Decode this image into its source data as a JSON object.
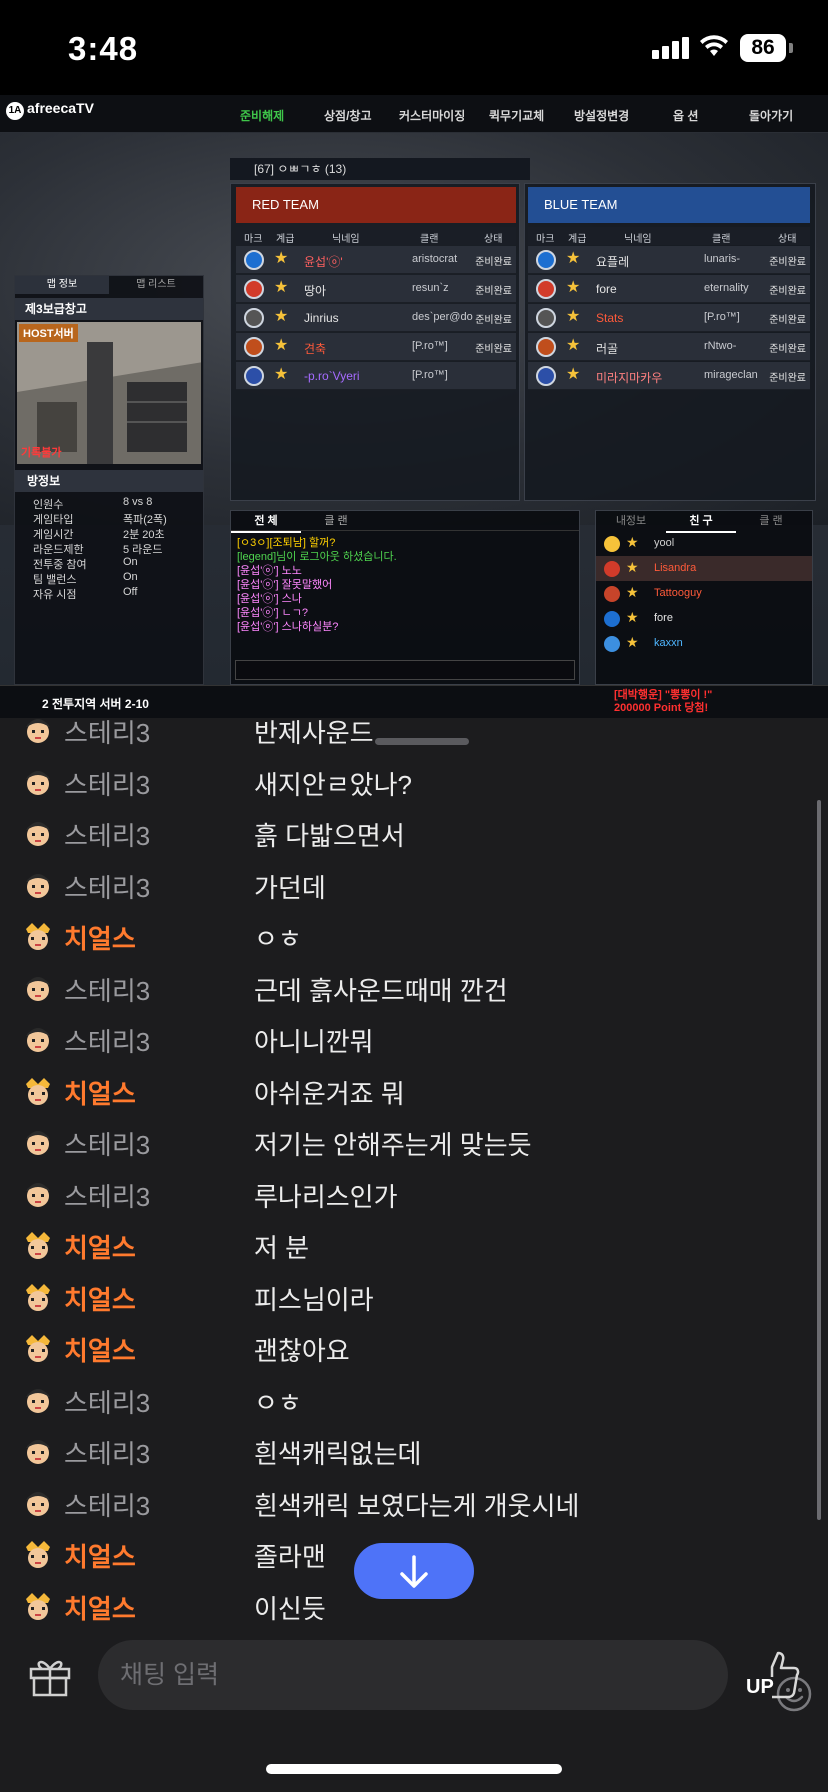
{
  "status_bar": {
    "time": "3:48",
    "battery": "86"
  },
  "game": {
    "logo": "afreecaTV",
    "menu": [
      {
        "label": "준비해제",
        "active": true
      },
      {
        "label": "상점/창고",
        "active": false
      },
      {
        "label": "커스터마이징",
        "active": false
      },
      {
        "label": "퀵무기교체",
        "active": false
      },
      {
        "label": "방설정변경",
        "active": false
      },
      {
        "label": "옵 션",
        "active": false
      },
      {
        "label": "돌아가기",
        "active": false
      }
    ],
    "room_title": "[67] ㅇㅃㄱㅎ (13)",
    "red_team": {
      "title": "RED TEAM",
      "columns": [
        "마크",
        "계급",
        "닉네임",
        "클랜",
        "상태"
      ],
      "players": [
        {
          "name": "윤섭'ⓞ'",
          "clan": "aristocrat",
          "status": "준비완료",
          "name_color": "#ff6060"
        },
        {
          "name": "땅아",
          "clan": "resun`z",
          "status": "준비완료",
          "name_color": "#e4e4e4"
        },
        {
          "name": "Jinrius",
          "clan": "des`per@do",
          "status": "준비완료",
          "name_color": "#e4e4e4"
        },
        {
          "name": "견축",
          "clan": "[P.ro™]",
          "status": "준비완료",
          "name_color": "#ff5a3a"
        },
        {
          "name": "-p.ro`Vyeri",
          "clan": "[P.ro™]",
          "status": "",
          "name_color": "#a56bff"
        }
      ]
    },
    "blue_team": {
      "title": "BLUE TEAM",
      "columns": [
        "마크",
        "계급",
        "닉네임",
        "클랜",
        "상태"
      ],
      "players": [
        {
          "name": "요플레",
          "clan": "lunaris-",
          "status": "준비완료",
          "name_color": "#e4e4e4"
        },
        {
          "name": "fore",
          "clan": "eternality",
          "status": "준비완료",
          "name_color": "#e4e4e4"
        },
        {
          "name": "Stats",
          "clan": "[P.ro™]",
          "status": "준비완료",
          "name_color": "#ff5a3a"
        },
        {
          "name": "러골",
          "clan": "rNtwo-",
          "status": "준비완료",
          "name_color": "#e4e4e4"
        },
        {
          "name": "미라지마카우",
          "clan": "mirageclan",
          "status": "준비완료",
          "name_color": "#ff8080"
        }
      ]
    },
    "map": {
      "tabs": [
        "맵 정보",
        "맵 리스트"
      ],
      "name": "제3보급창고",
      "host_badge": "HOST서버",
      "record": "기록불가"
    },
    "room_info": {
      "title": "방정보",
      "rows": [
        {
          "k": "인원수",
          "v": "8 vs 8"
        },
        {
          "k": "게임타입",
          "v": "폭파(2폭)"
        },
        {
          "k": "게임시간",
          "v": "2분 20초"
        },
        {
          "k": "라운드제한",
          "v": "5 라운드"
        },
        {
          "k": "전투중 참여",
          "v": "On"
        },
        {
          "k": "팀 밸런스",
          "v": "On"
        },
        {
          "k": "자유 시점",
          "v": "Off"
        }
      ]
    },
    "chat": {
      "tabs": [
        "전 체",
        "클 랜"
      ],
      "lines": [
        {
          "text": "[ㅇ3ㅇ][조퇴남] 할꺼?",
          "color": "#ffd000"
        },
        {
          "text": "[legend]님이 로그아웃 하셨습니다.",
          "color": "#4fd44f"
        },
        {
          "text": "[윤섭'ⓞ'] 노노",
          "color": "#ff88ff"
        },
        {
          "text": "[윤섭'ⓞ'] 잘못말했어",
          "color": "#ff88ff"
        },
        {
          "text": "[윤섭'ⓞ'] 스나",
          "color": "#ff88ff"
        },
        {
          "text": "[윤섭'ⓞ'] ㄴㄱ?",
          "color": "#ff88ff"
        },
        {
          "text": "[윤섭'ⓞ'] 스나하실분?",
          "color": "#ff88ff"
        }
      ]
    },
    "friends": {
      "tabs": [
        "내정보",
        "친 구",
        "클 랜"
      ],
      "list": [
        {
          "name": "yool",
          "color": "#cfcfcf"
        },
        {
          "name": "Lisandra",
          "color": "#ff5a3a"
        },
        {
          "name": "Tattooguy",
          "color": "#ff5a3a"
        },
        {
          "name": "fore",
          "color": "#e4e4e4"
        },
        {
          "name": "kaxxn",
          "color": "#4fb6ff"
        }
      ]
    },
    "bottom": {
      "server": "2 전투지역 서버 2-10",
      "promo1": "[대박행운] \"뽕뽕이 !\"",
      "promo2": "200000 Point 당첨!"
    }
  },
  "chat_messages": [
    {
      "user": "스테리3",
      "vip": false,
      "text": "반제사운드"
    },
    {
      "user": "스테리3",
      "vip": false,
      "text": "새지안ㄹ았나?"
    },
    {
      "user": "스테리3",
      "vip": false,
      "text": "흙 다밟으면서"
    },
    {
      "user": "스테리3",
      "vip": false,
      "text": "가던데"
    },
    {
      "user": "치얼스",
      "vip": true,
      "text": "ㅇㅎ"
    },
    {
      "user": "스테리3",
      "vip": false,
      "text": "근데 흙사운드때매 깐건"
    },
    {
      "user": "스테리3",
      "vip": false,
      "text": "아니니깐뭐"
    },
    {
      "user": "치얼스",
      "vip": true,
      "text": "아쉬운거죠 뭐"
    },
    {
      "user": "스테리3",
      "vip": false,
      "text": "저기는 안해주는게 맞는듯"
    },
    {
      "user": "스테리3",
      "vip": false,
      "text": "루나리스인가"
    },
    {
      "user": "치얼스",
      "vip": true,
      "text": "저 분"
    },
    {
      "user": "치얼스",
      "vip": true,
      "text": "피스님이라"
    },
    {
      "user": "치얼스",
      "vip": true,
      "text": "괜찮아요"
    },
    {
      "user": "스테리3",
      "vip": false,
      "text": "ㅇㅎ"
    },
    {
      "user": "스테리3",
      "vip": false,
      "text": "흰색캐릭없는데"
    },
    {
      "user": "스테리3",
      "vip": false,
      "text": "흰색캐릭 보였다는게 개웃시네"
    },
    {
      "user": "치얼스",
      "vip": true,
      "text": "졸라맨"
    },
    {
      "user": "치얼스",
      "vip": true,
      "text": "이신듯"
    }
  ],
  "input": {
    "placeholder": "채팅 입력"
  },
  "up_label": "UP"
}
